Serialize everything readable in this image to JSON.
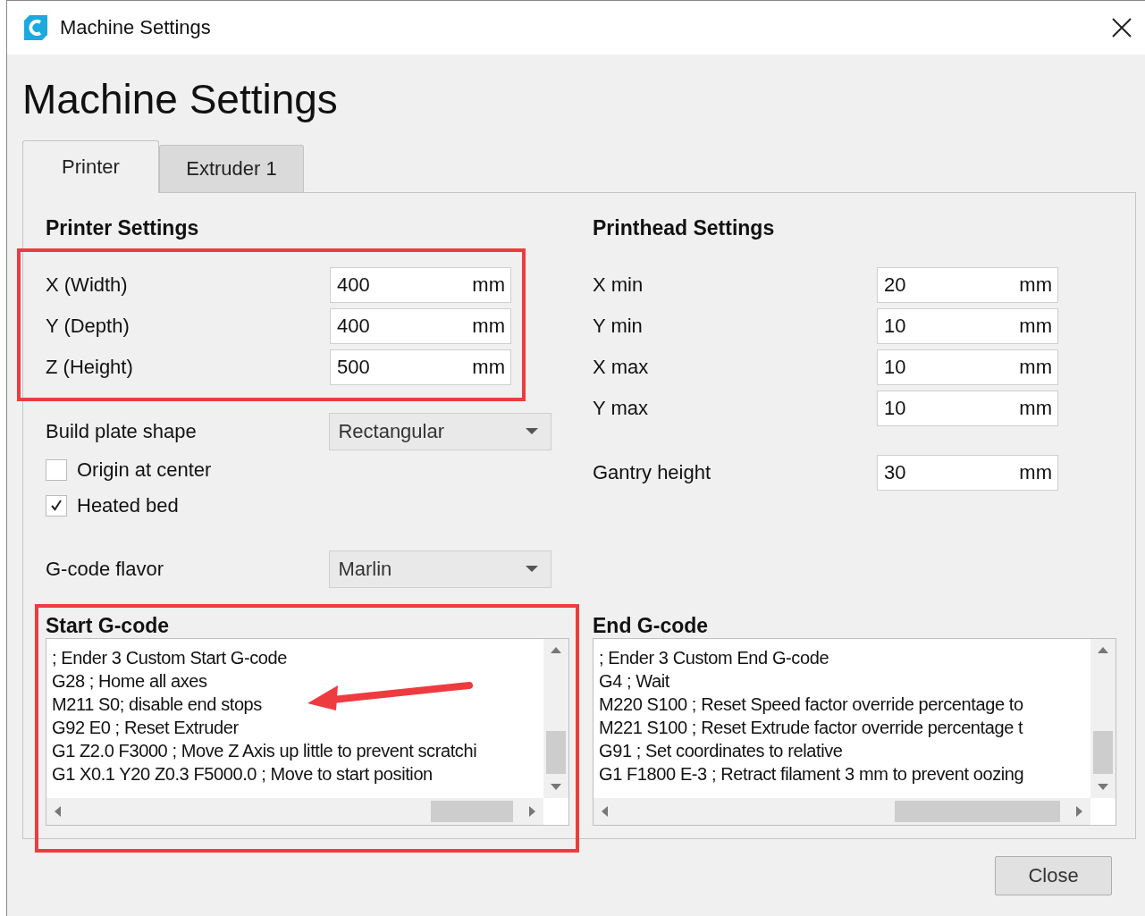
{
  "window": {
    "title": "Machine Settings"
  },
  "heading": "Machine Settings",
  "tabs": [
    {
      "label": "Printer",
      "selected": true
    },
    {
      "label": "Extruder 1",
      "selected": false
    }
  ],
  "printer_settings": {
    "title": "Printer Settings",
    "fields": [
      {
        "label": "X (Width)",
        "value": "400",
        "unit": "mm"
      },
      {
        "label": "Y (Depth)",
        "value": "400",
        "unit": "mm"
      },
      {
        "label": "Z (Height)",
        "value": "500",
        "unit": "mm"
      }
    ],
    "build_plate_shape": {
      "label": "Build plate shape",
      "value": "Rectangular"
    },
    "checkboxes": [
      {
        "label": "Origin at center",
        "checked": false
      },
      {
        "label": "Heated bed",
        "checked": true
      }
    ],
    "gcode_flavor": {
      "label": "G-code flavor",
      "value": "Marlin"
    }
  },
  "printhead_settings": {
    "title": "Printhead Settings",
    "fields": [
      {
        "label": "X min",
        "value": "20",
        "unit": "mm"
      },
      {
        "label": "Y min",
        "value": "10",
        "unit": "mm"
      },
      {
        "label": "X max",
        "value": "10",
        "unit": "mm"
      },
      {
        "label": "Y max",
        "value": "10",
        "unit": "mm"
      }
    ],
    "gantry_height": {
      "label": "Gantry height",
      "value": "30",
      "unit": "mm"
    }
  },
  "start_gcode": {
    "title": "Start G-code",
    "lines": [
      "; Ender 3 Custom Start G-code",
      "G28 ; Home all axes",
      "M211 S0; disable end stops",
      "G92 E0 ; Reset Extruder",
      "G1 Z2.0 F3000 ; Move Z Axis up little to prevent scratchi",
      "G1 X0.1 Y20 Z0.3 F5000.0 ; Move to start position"
    ]
  },
  "end_gcode": {
    "title": "End G-code",
    "lines": [
      "; Ender 3 Custom End G-code",
      "G4 ; Wait",
      "M220 S100 ; Reset Speed factor override percentage to",
      "M221 S100 ; Reset Extrude factor override percentage t",
      "G91 ; Set coordinates to relative",
      "G1 F1800 E-3 ; Retract filament 3 mm to prevent oozing"
    ]
  },
  "buttons": [
    {
      "label": "Close"
    }
  ]
}
